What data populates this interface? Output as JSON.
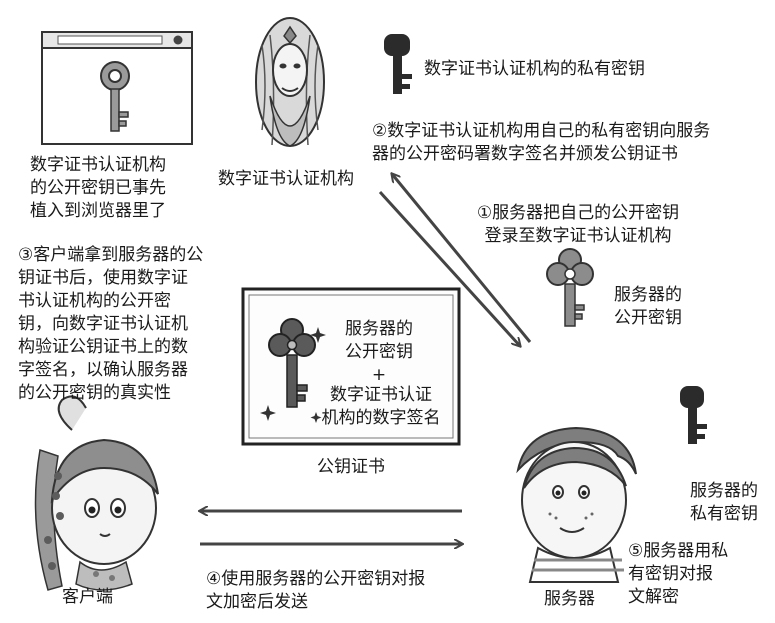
{
  "browser_note": "数字证书认证机构\n的公开密钥已事先\n植入到浏览器里了",
  "ca": {
    "label": "数字证书认证机构",
    "private_key_label": "数字证书认证机构的私有密钥"
  },
  "steps": {
    "step1": "①服务器把自己的公开密钥\n登录至数字证书认证机构",
    "step2": "②数字证书认证机构用自己的私有密钥向服务\n器的公开密码署数字签名并颁发公钥证书",
    "step3": "③客户端拿到服务器的公\n钥证书后，使用数字证\n书认证机构的公开密\n钥，向数字证书认证机\n构验证公钥证书上的数\n字签名，以确认服务器\n的公开密钥的真实性",
    "step4": "④使用服务器的公开密钥对报\n文加密后发送",
    "step5": "⑤服务器用私\n有密钥对报\n文解密"
  },
  "certificate": {
    "line1": "服务器的\n公开密钥",
    "plus": "+",
    "line2": "数字证书认证\n机构的数字签名",
    "caption": "公钥证书"
  },
  "server": {
    "label": "服务器",
    "public_key_label": "服务器的\n公开密钥",
    "private_key_label": "服务器的\n私有密钥"
  },
  "client": {
    "label": "客户端"
  },
  "colors": {
    "ink": "#1a1a1a",
    "key_dark": "#2b2b2b",
    "key_gray": "#8c8c8c",
    "cert_key": "#5a5a5a",
    "panel": "#f2f2f2"
  }
}
